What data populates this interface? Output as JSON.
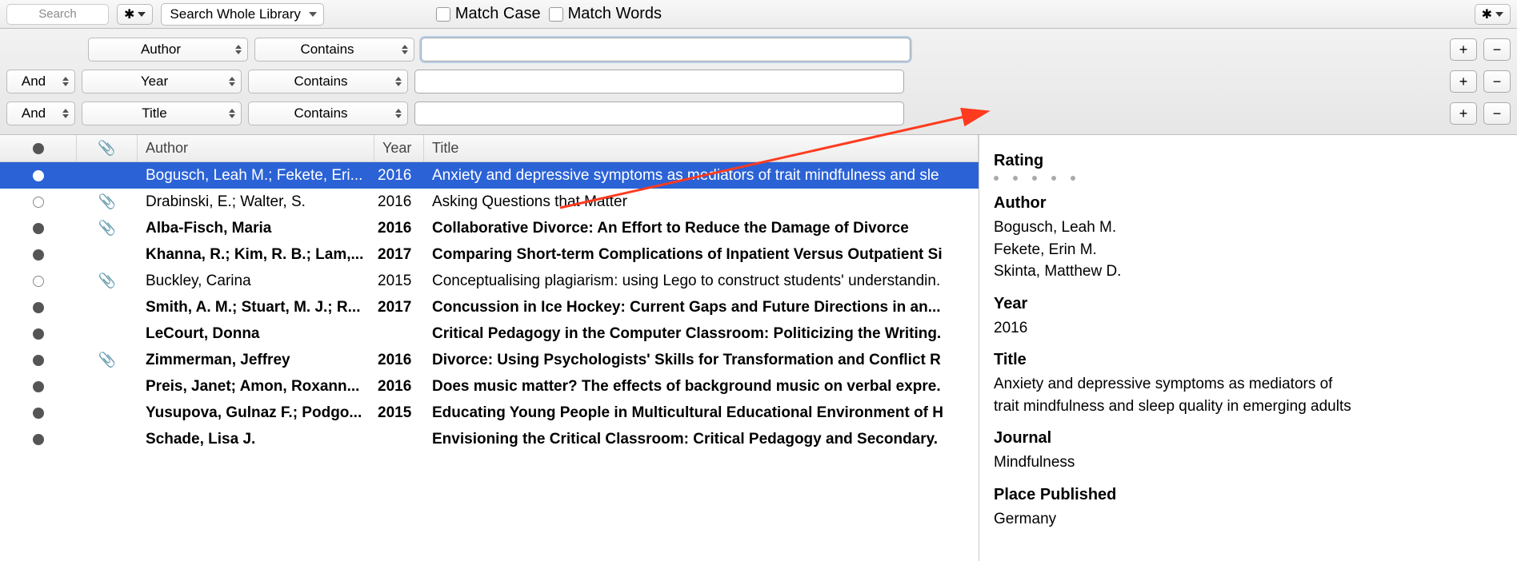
{
  "toolbar": {
    "search_placeholder": "Search",
    "scope": "Search Whole Library",
    "match_case": "Match Case",
    "match_words": "Match Words"
  },
  "advanced": {
    "rows": [
      {
        "op": "",
        "field": "Author",
        "mode": "Contains"
      },
      {
        "op": "And",
        "field": "Year",
        "mode": "Contains"
      },
      {
        "op": "And",
        "field": "Title",
        "mode": "Contains"
      }
    ],
    "plus": "+",
    "minus": "−"
  },
  "columns": {
    "author": "Author",
    "year": "Year",
    "title": "Title"
  },
  "table": [
    {
      "read": "filled",
      "attach": false,
      "bold": false,
      "sel": true,
      "author": "Bogusch, Leah M.; Fekete, Eri...",
      "year": "2016",
      "title": "Anxiety and depressive symptoms as mediators of trait mindfulness and sle"
    },
    {
      "read": "hollow",
      "attach": true,
      "bold": false,
      "sel": false,
      "author": "Drabinski, E.; Walter, S.",
      "year": "2016",
      "title": "Asking Questions that Matter"
    },
    {
      "read": "filled",
      "attach": true,
      "bold": true,
      "sel": false,
      "author": "Alba-Fisch, Maria",
      "year": "2016",
      "title": "Collaborative Divorce: An Effort to Reduce the Damage of Divorce"
    },
    {
      "read": "filled",
      "attach": false,
      "bold": true,
      "sel": false,
      "author": "Khanna, R.; Kim, R. B.; Lam,...",
      "year": "2017",
      "title": "Comparing Short-term Complications of Inpatient Versus Outpatient Si"
    },
    {
      "read": "hollow",
      "attach": true,
      "bold": false,
      "sel": false,
      "author": "Buckley, Carina",
      "year": "2015",
      "title": "Conceptualising plagiarism: using Lego to construct students' understandin."
    },
    {
      "read": "filled",
      "attach": false,
      "bold": true,
      "sel": false,
      "author": "Smith, A. M.; Stuart, M. J.; R...",
      "year": "2017",
      "title": "Concussion in Ice Hockey: Current Gaps and Future Directions in an..."
    },
    {
      "read": "filled",
      "attach": false,
      "bold": true,
      "sel": false,
      "author": "LeCourt, Donna",
      "year": "",
      "title": "Critical Pedagogy in the Computer Classroom: Politicizing the Writing."
    },
    {
      "read": "filled",
      "attach": true,
      "bold": true,
      "sel": false,
      "author": "Zimmerman, Jeffrey",
      "year": "2016",
      "title": "Divorce: Using Psychologists' Skills for Transformation and Conflict R"
    },
    {
      "read": "filled",
      "attach": false,
      "bold": true,
      "sel": false,
      "author": "Preis, Janet; Amon, Roxann...",
      "year": "2016",
      "title": "Does music matter? The effects of background music on verbal expre."
    },
    {
      "read": "filled",
      "attach": false,
      "bold": true,
      "sel": false,
      "author": "Yusupova, Gulnaz F.; Podgo...",
      "year": "2015",
      "title": "Educating Young People in Multicultural Educational Environment of H"
    },
    {
      "read": "filled",
      "attach": false,
      "bold": true,
      "sel": false,
      "author": "Schade, Lisa J.",
      "year": "",
      "title": "Envisioning the Critical Classroom: Critical Pedagogy and Secondary."
    }
  ],
  "detail": {
    "rating_label": "Rating",
    "author_label": "Author",
    "authors": [
      "Bogusch, Leah M.",
      "Fekete, Erin M.",
      "Skinta, Matthew D."
    ],
    "year_label": "Year",
    "year": "2016",
    "title_label": "Title",
    "title": "Anxiety and depressive symptoms as mediators of trait mindfulness and sleep quality in emerging adults",
    "journal_label": "Journal",
    "journal": "Mindfulness",
    "place_label": "Place Published",
    "place": "Germany"
  }
}
